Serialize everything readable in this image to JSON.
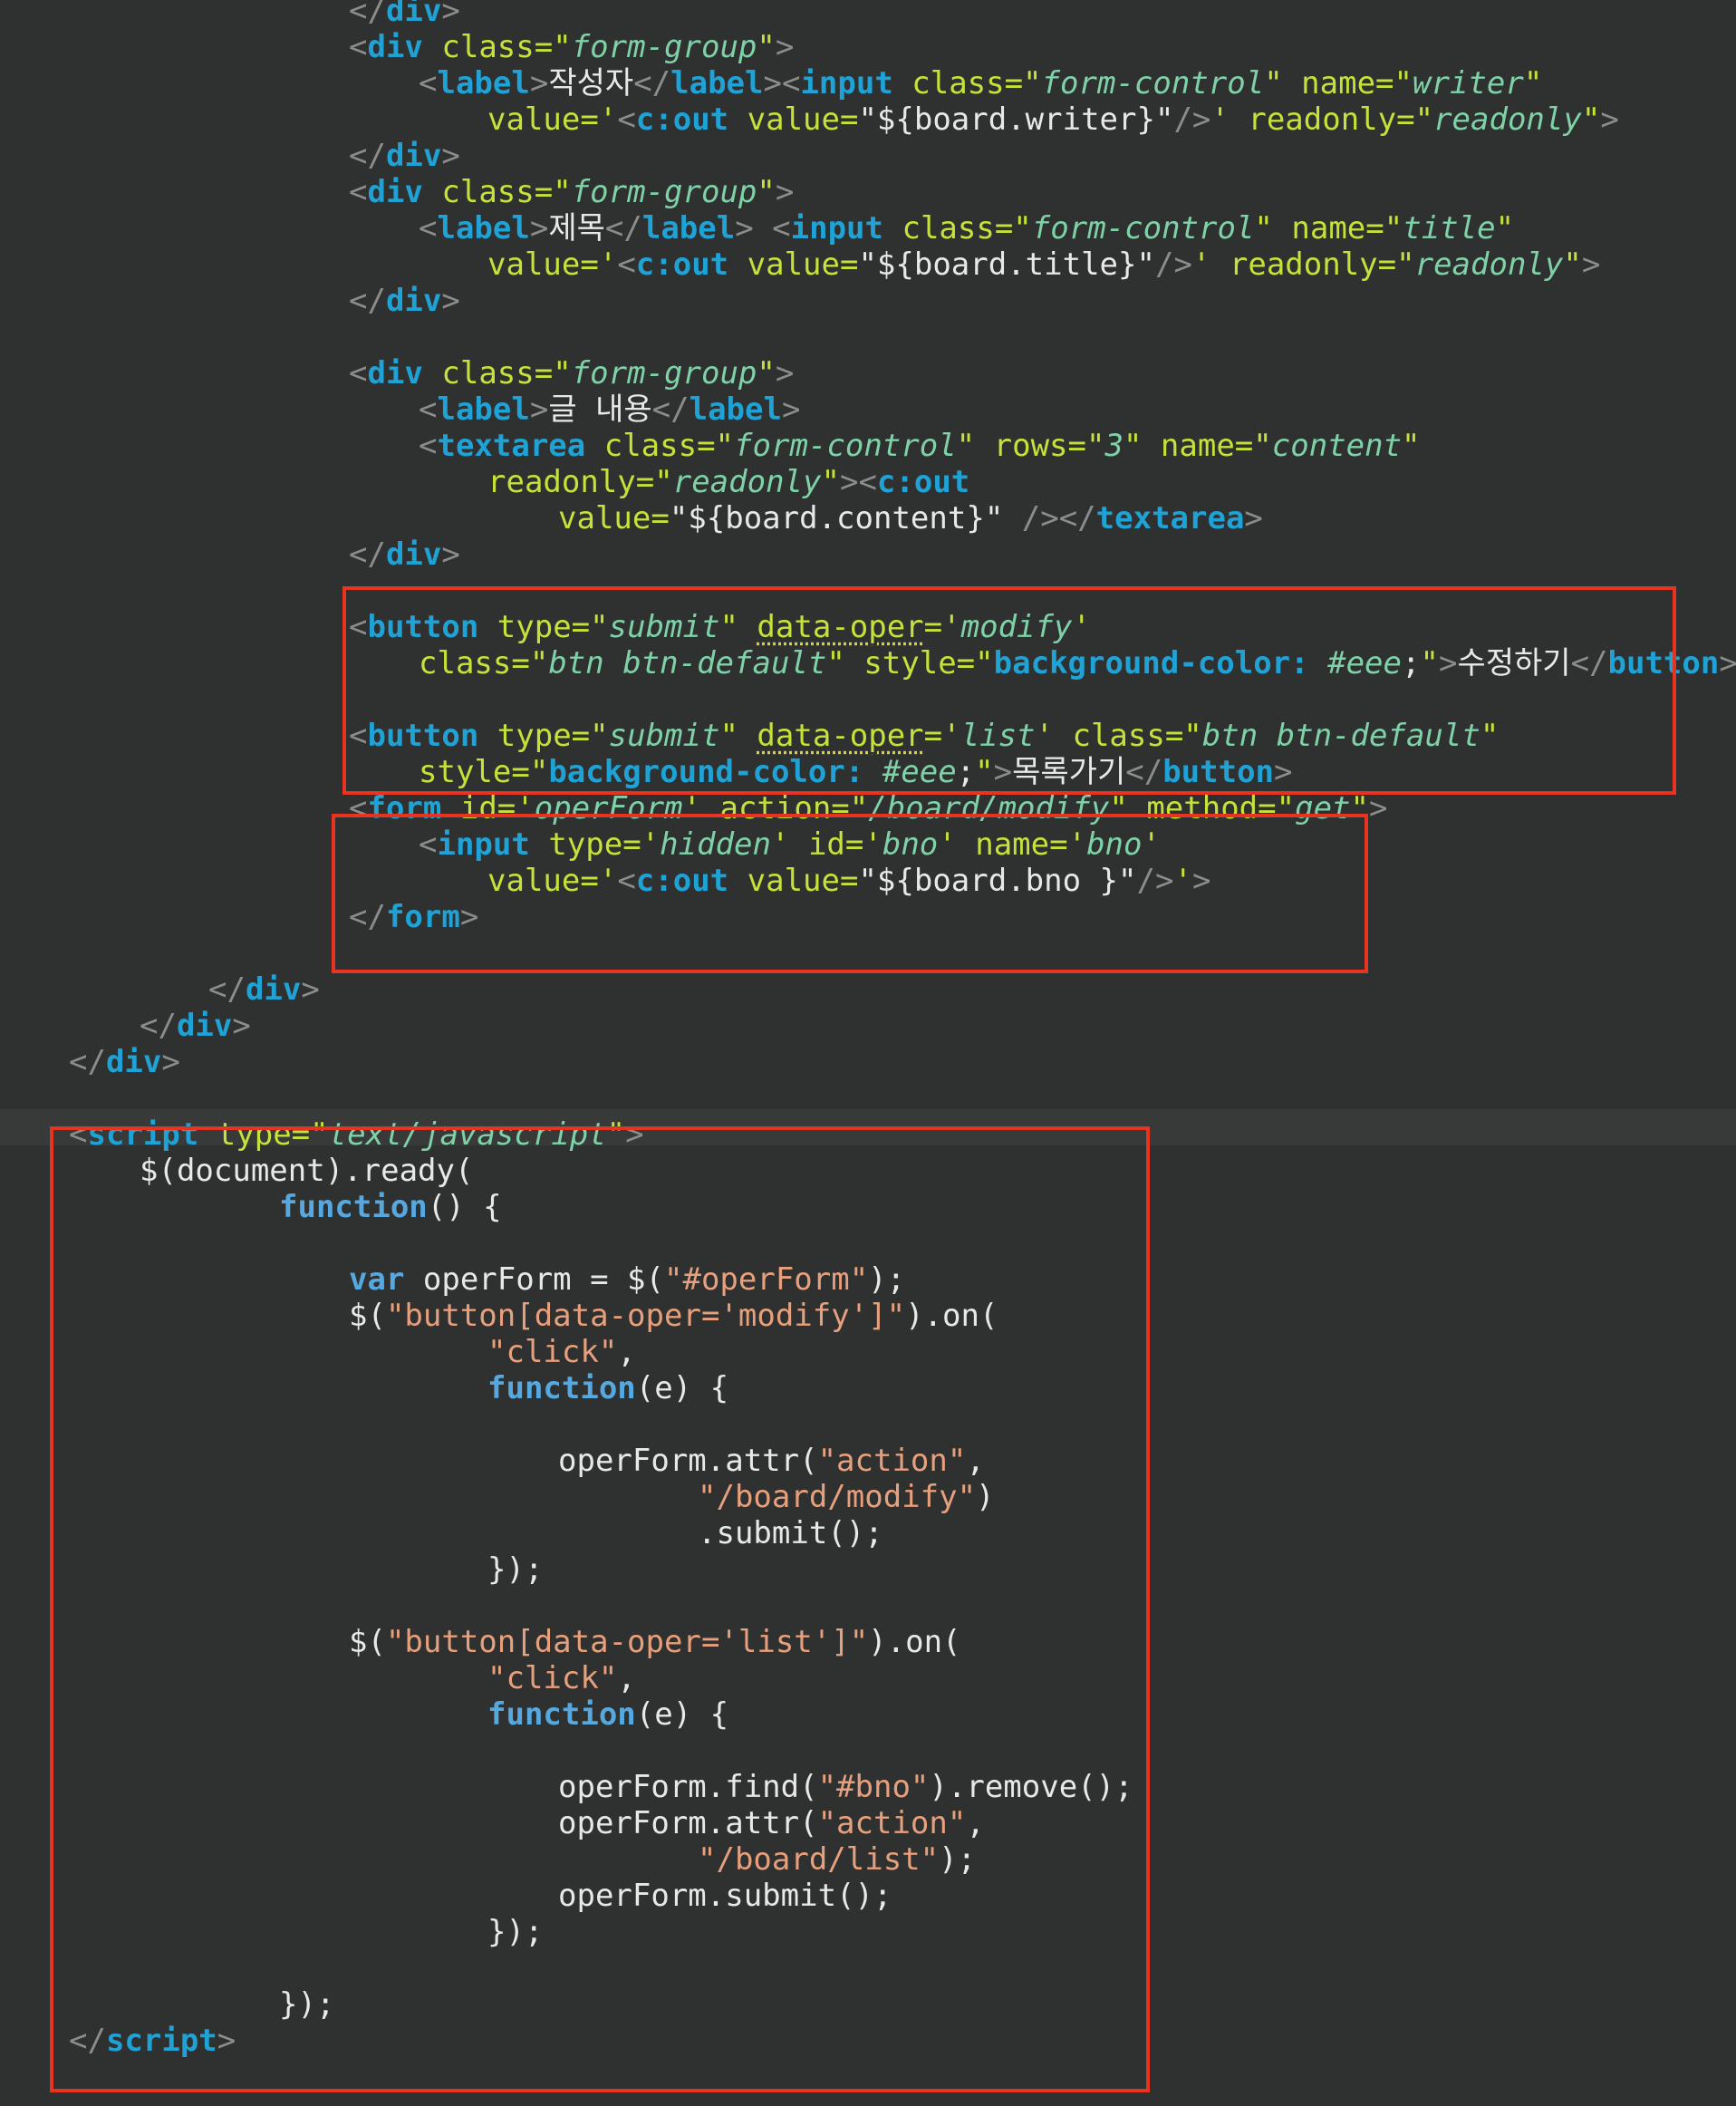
{
  "editor": {
    "colors": {
      "background": "#2f3030",
      "current_line": "#383939",
      "tag": "#1fa3d6",
      "attribute": "#c4e23a",
      "html_string": "#7fd1a8",
      "js_string": "#e7a07d",
      "keyword": "#56a8e0",
      "bracket": "#8c8c8c",
      "plain": "#e8e8e8",
      "highlight_box": "#e63322"
    },
    "lines": [
      [
        {
          "t": "</",
          "c": "bracket"
        },
        {
          "t": "div",
          "c": "tag"
        },
        {
          "t": ">",
          "c": "bracket"
        }
      ],
      [
        {
          "t": "<",
          "c": "bracket"
        },
        {
          "t": "div",
          "c": "tag"
        },
        {
          "t": " class=",
          "c": "attr"
        },
        {
          "t": "\"",
          "c": "attr"
        },
        {
          "t": "form-group",
          "c": "str"
        },
        {
          "t": "\"",
          "c": "attr"
        },
        {
          "t": ">",
          "c": "bracket"
        }
      ],
      [
        {
          "t": "<",
          "c": "bracket"
        },
        {
          "t": "label",
          "c": "tag"
        },
        {
          "t": ">",
          "c": "bracket"
        },
        {
          "t": "작성자",
          "c": "plain"
        },
        {
          "t": "</",
          "c": "bracket"
        },
        {
          "t": "label",
          "c": "tag"
        },
        {
          "t": "><",
          "c": "bracket"
        },
        {
          "t": "input",
          "c": "tag"
        },
        {
          "t": " class=",
          "c": "attr"
        },
        {
          "t": "\"",
          "c": "attr"
        },
        {
          "t": "form-control",
          "c": "str"
        },
        {
          "t": "\"",
          "c": "attr"
        },
        {
          "t": " name=",
          "c": "attr"
        },
        {
          "t": "\"",
          "c": "attr"
        },
        {
          "t": "writer",
          "c": "str"
        },
        {
          "t": "\"",
          "c": "attr"
        }
      ],
      [
        {
          "t": "value=",
          "c": "attr"
        },
        {
          "t": "'",
          "c": "attr"
        },
        {
          "t": "<",
          "c": "bracket"
        },
        {
          "t": "c:out",
          "c": "tag"
        },
        {
          "t": " value=",
          "c": "attr"
        },
        {
          "t": "\"${board.writer}\"",
          "c": "plain"
        },
        {
          "t": "/>",
          "c": "bracket"
        },
        {
          "t": "'",
          "c": "attr"
        },
        {
          "t": " readonly=",
          "c": "attr"
        },
        {
          "t": "\"",
          "c": "attr"
        },
        {
          "t": "readonly",
          "c": "str"
        },
        {
          "t": "\"",
          "c": "attr"
        },
        {
          "t": ">",
          "c": "bracket"
        }
      ],
      [
        {
          "t": "</",
          "c": "bracket"
        },
        {
          "t": "div",
          "c": "tag"
        },
        {
          "t": ">",
          "c": "bracket"
        }
      ],
      [
        {
          "t": "<",
          "c": "bracket"
        },
        {
          "t": "div",
          "c": "tag"
        },
        {
          "t": " class=",
          "c": "attr"
        },
        {
          "t": "\"",
          "c": "attr"
        },
        {
          "t": "form-group",
          "c": "str"
        },
        {
          "t": "\"",
          "c": "attr"
        },
        {
          "t": ">",
          "c": "bracket"
        }
      ],
      [
        {
          "t": "<",
          "c": "bracket"
        },
        {
          "t": "label",
          "c": "tag"
        },
        {
          "t": ">",
          "c": "bracket"
        },
        {
          "t": "제목",
          "c": "plain"
        },
        {
          "t": "</",
          "c": "bracket"
        },
        {
          "t": "label",
          "c": "tag"
        },
        {
          "t": ">",
          "c": "bracket"
        },
        {
          "t": " <",
          "c": "bracket"
        },
        {
          "t": "input",
          "c": "tag"
        },
        {
          "t": " class=",
          "c": "attr"
        },
        {
          "t": "\"",
          "c": "attr"
        },
        {
          "t": "form-control",
          "c": "str"
        },
        {
          "t": "\"",
          "c": "attr"
        },
        {
          "t": " name=",
          "c": "attr"
        },
        {
          "t": "\"",
          "c": "attr"
        },
        {
          "t": "title",
          "c": "str"
        },
        {
          "t": "\"",
          "c": "attr"
        }
      ],
      [
        {
          "t": "value=",
          "c": "attr"
        },
        {
          "t": "'",
          "c": "attr"
        },
        {
          "t": "<",
          "c": "bracket"
        },
        {
          "t": "c:out",
          "c": "tag"
        },
        {
          "t": " value=",
          "c": "attr"
        },
        {
          "t": "\"${board.title}\"",
          "c": "plain"
        },
        {
          "t": "/>",
          "c": "bracket"
        },
        {
          "t": "'",
          "c": "attr"
        },
        {
          "t": " readonly=",
          "c": "attr"
        },
        {
          "t": "\"",
          "c": "attr"
        },
        {
          "t": "readonly",
          "c": "str"
        },
        {
          "t": "\"",
          "c": "attr"
        },
        {
          "t": ">",
          "c": "bracket"
        }
      ],
      [
        {
          "t": "</",
          "c": "bracket"
        },
        {
          "t": "div",
          "c": "tag"
        },
        {
          "t": ">",
          "c": "bracket"
        }
      ],
      [],
      [
        {
          "t": "<",
          "c": "bracket"
        },
        {
          "t": "div",
          "c": "tag"
        },
        {
          "t": " class=",
          "c": "attr"
        },
        {
          "t": "\"",
          "c": "attr"
        },
        {
          "t": "form-group",
          "c": "str"
        },
        {
          "t": "\"",
          "c": "attr"
        },
        {
          "t": ">",
          "c": "bracket"
        }
      ],
      [
        {
          "t": "<",
          "c": "bracket"
        },
        {
          "t": "label",
          "c": "tag"
        },
        {
          "t": ">",
          "c": "bracket"
        },
        {
          "t": "글 내용",
          "c": "plain"
        },
        {
          "t": "</",
          "c": "bracket"
        },
        {
          "t": "label",
          "c": "tag"
        },
        {
          "t": ">",
          "c": "bracket"
        }
      ],
      [
        {
          "t": "<",
          "c": "bracket"
        },
        {
          "t": "textarea",
          "c": "tag"
        },
        {
          "t": " class=",
          "c": "attr"
        },
        {
          "t": "\"",
          "c": "attr"
        },
        {
          "t": "form-control",
          "c": "str"
        },
        {
          "t": "\"",
          "c": "attr"
        },
        {
          "t": " rows=",
          "c": "attr"
        },
        {
          "t": "\"",
          "c": "attr"
        },
        {
          "t": "3",
          "c": "str"
        },
        {
          "t": "\"",
          "c": "attr"
        },
        {
          "t": " name=",
          "c": "attr"
        },
        {
          "t": "\"",
          "c": "attr"
        },
        {
          "t": "content",
          "c": "str"
        },
        {
          "t": "\"",
          "c": "attr"
        }
      ],
      [
        {
          "t": "readonly=",
          "c": "attr"
        },
        {
          "t": "\"",
          "c": "attr"
        },
        {
          "t": "readonly",
          "c": "str"
        },
        {
          "t": "\"",
          "c": "attr"
        },
        {
          "t": "><",
          "c": "bracket"
        },
        {
          "t": "c:out",
          "c": "tag"
        }
      ],
      [
        {
          "t": "value=",
          "c": "attr"
        },
        {
          "t": "\"${board.content}\"",
          "c": "plain"
        },
        {
          "t": " /></",
          "c": "bracket"
        },
        {
          "t": "textarea",
          "c": "tag"
        },
        {
          "t": ">",
          "c": "bracket"
        }
      ],
      [
        {
          "t": "</",
          "c": "bracket"
        },
        {
          "t": "div",
          "c": "tag"
        },
        {
          "t": ">",
          "c": "bracket"
        }
      ],
      [],
      [
        {
          "t": "<",
          "c": "bracket"
        },
        {
          "t": "button",
          "c": "tag"
        },
        {
          "t": " type=",
          "c": "attr"
        },
        {
          "t": "\"",
          "c": "attr"
        },
        {
          "t": "submit",
          "c": "str"
        },
        {
          "t": "\"",
          "c": "attr"
        },
        {
          "t": " ",
          "c": "plain"
        },
        {
          "t": "data-oper",
          "c": "warn"
        },
        {
          "t": "=",
          "c": "attr"
        },
        {
          "t": "'",
          "c": "attr"
        },
        {
          "t": "modify",
          "c": "str"
        },
        {
          "t": "'",
          "c": "attr"
        }
      ],
      [
        {
          "t": "class=",
          "c": "attr"
        },
        {
          "t": "\"",
          "c": "attr"
        },
        {
          "t": "btn btn-default",
          "c": "str"
        },
        {
          "t": "\"",
          "c": "attr"
        },
        {
          "t": " style=",
          "c": "attr"
        },
        {
          "t": "\"",
          "c": "attr"
        },
        {
          "t": "background-color:",
          "c": "tag"
        },
        {
          "t": " #eee",
          "c": "str"
        },
        {
          "t": ";",
          "c": "plain"
        },
        {
          "t": "\"",
          "c": "attr"
        },
        {
          "t": ">",
          "c": "bracket"
        },
        {
          "t": "수정하기",
          "c": "plain"
        },
        {
          "t": "</",
          "c": "bracket"
        },
        {
          "t": "button",
          "c": "tag"
        },
        {
          "t": ">",
          "c": "bracket"
        }
      ],
      [],
      [
        {
          "t": "<",
          "c": "bracket"
        },
        {
          "t": "button",
          "c": "tag"
        },
        {
          "t": " type=",
          "c": "attr"
        },
        {
          "t": "\"",
          "c": "attr"
        },
        {
          "t": "submit",
          "c": "str"
        },
        {
          "t": "\"",
          "c": "attr"
        },
        {
          "t": " ",
          "c": "plain"
        },
        {
          "t": "data-oper",
          "c": "warn"
        },
        {
          "t": "=",
          "c": "attr"
        },
        {
          "t": "'",
          "c": "attr"
        },
        {
          "t": "list",
          "c": "str"
        },
        {
          "t": "'",
          "c": "attr"
        },
        {
          "t": " class=",
          "c": "attr"
        },
        {
          "t": "\"",
          "c": "attr"
        },
        {
          "t": "btn btn-default",
          "c": "str"
        },
        {
          "t": "\"",
          "c": "attr"
        }
      ],
      [
        {
          "t": "style=",
          "c": "attr"
        },
        {
          "t": "\"",
          "c": "attr"
        },
        {
          "t": "background-color:",
          "c": "tag"
        },
        {
          "t": " #eee",
          "c": "str"
        },
        {
          "t": ";",
          "c": "plain"
        },
        {
          "t": "\"",
          "c": "attr"
        },
        {
          "t": ">",
          "c": "bracket"
        },
        {
          "t": "목록가기",
          "c": "plain"
        },
        {
          "t": "</",
          "c": "bracket"
        },
        {
          "t": "button",
          "c": "tag"
        },
        {
          "t": ">",
          "c": "bracket"
        }
      ],
      [
        {
          "t": "<",
          "c": "bracket"
        },
        {
          "t": "form",
          "c": "tag"
        },
        {
          "t": " id=",
          "c": "attr"
        },
        {
          "t": "'",
          "c": "attr"
        },
        {
          "t": "operForm",
          "c": "str"
        },
        {
          "t": "'",
          "c": "attr"
        },
        {
          "t": " action=",
          "c": "attr"
        },
        {
          "t": "\"",
          "c": "attr"
        },
        {
          "t": "/board/modify",
          "c": "str"
        },
        {
          "t": "\"",
          "c": "attr"
        },
        {
          "t": " method=",
          "c": "attr"
        },
        {
          "t": "\"",
          "c": "attr"
        },
        {
          "t": "get",
          "c": "str"
        },
        {
          "t": "\"",
          "c": "attr"
        },
        {
          "t": ">",
          "c": "bracket"
        }
      ],
      [
        {
          "t": "<",
          "c": "bracket"
        },
        {
          "t": "input",
          "c": "tag"
        },
        {
          "t": " type=",
          "c": "attr"
        },
        {
          "t": "'",
          "c": "attr"
        },
        {
          "t": "hidden",
          "c": "str"
        },
        {
          "t": "'",
          "c": "attr"
        },
        {
          "t": " id=",
          "c": "attr"
        },
        {
          "t": "'",
          "c": "attr"
        },
        {
          "t": "bno",
          "c": "str"
        },
        {
          "t": "'",
          "c": "attr"
        },
        {
          "t": " name=",
          "c": "attr"
        },
        {
          "t": "'",
          "c": "attr"
        },
        {
          "t": "bno",
          "c": "str"
        },
        {
          "t": "'",
          "c": "attr"
        }
      ],
      [
        {
          "t": "value=",
          "c": "attr"
        },
        {
          "t": "'",
          "c": "attr"
        },
        {
          "t": "<",
          "c": "bracket"
        },
        {
          "t": "c:out",
          "c": "tag"
        },
        {
          "t": " value=",
          "c": "attr"
        },
        {
          "t": "\"${board.bno }\"",
          "c": "plain"
        },
        {
          "t": "/>",
          "c": "bracket"
        },
        {
          "t": "'",
          "c": "attr"
        },
        {
          "t": ">",
          "c": "bracket"
        }
      ],
      [
        {
          "t": "</",
          "c": "bracket"
        },
        {
          "t": "form",
          "c": "tag"
        },
        {
          "t": ">",
          "c": "bracket"
        }
      ],
      [],
      [
        {
          "t": "</",
          "c": "bracket"
        },
        {
          "t": "div",
          "c": "tag"
        },
        {
          "t": ">",
          "c": "bracket"
        }
      ],
      [
        {
          "t": "</",
          "c": "bracket"
        },
        {
          "t": "div",
          "c": "tag"
        },
        {
          "t": ">",
          "c": "bracket"
        }
      ],
      [
        {
          "t": "</",
          "c": "bracket"
        },
        {
          "t": "div",
          "c": "tag"
        },
        {
          "t": ">",
          "c": "bracket"
        }
      ],
      [],
      [
        {
          "t": "<",
          "c": "bracket"
        },
        {
          "t": "script",
          "c": "tag"
        },
        {
          "t": " type=",
          "c": "attr"
        },
        {
          "t": "\"",
          "c": "attr"
        },
        {
          "t": "text/javascript",
          "c": "str"
        },
        {
          "t": "\"",
          "c": "attr"
        },
        {
          "t": ">",
          "c": "bracket"
        }
      ],
      [
        {
          "t": "$(document).ready(",
          "c": "plain"
        }
      ],
      [
        {
          "t": "function",
          "c": "kw"
        },
        {
          "t": "() {",
          "c": "plain"
        }
      ],
      [],
      [
        {
          "t": "var",
          "c": "kw"
        },
        {
          "t": " operForm = $(",
          "c": "plain"
        },
        {
          "t": "\"#operForm\"",
          "c": "jsstr"
        },
        {
          "t": ");",
          "c": "plain"
        }
      ],
      [
        {
          "t": "$(",
          "c": "plain"
        },
        {
          "t": "\"button[data-oper='modify']\"",
          "c": "jsstr"
        },
        {
          "t": ").on(",
          "c": "plain"
        }
      ],
      [
        {
          "t": "\"click\"",
          "c": "jsstr"
        },
        {
          "t": ",",
          "c": "plain"
        }
      ],
      [
        {
          "t": "function",
          "c": "kw"
        },
        {
          "t": "(e) {",
          "c": "plain"
        }
      ],
      [],
      [
        {
          "t": "operForm.attr(",
          "c": "plain"
        },
        {
          "t": "\"action\"",
          "c": "jsstr"
        },
        {
          "t": ",",
          "c": "plain"
        }
      ],
      [
        {
          "t": "\"/board/modify\"",
          "c": "jsstr"
        },
        {
          "t": ")",
          "c": "plain"
        }
      ],
      [
        {
          "t": ".submit();",
          "c": "plain"
        }
      ],
      [
        {
          "t": "});",
          "c": "plain"
        }
      ],
      [],
      [
        {
          "t": "$(",
          "c": "plain"
        },
        {
          "t": "\"button[data-oper='list']\"",
          "c": "jsstr"
        },
        {
          "t": ").on(",
          "c": "plain"
        }
      ],
      [
        {
          "t": "\"click\"",
          "c": "jsstr"
        },
        {
          "t": ",",
          "c": "plain"
        }
      ],
      [
        {
          "t": "function",
          "c": "kw"
        },
        {
          "t": "(e) {",
          "c": "plain"
        }
      ],
      [],
      [
        {
          "t": "operForm.find(",
          "c": "plain"
        },
        {
          "t": "\"#bno\"",
          "c": "jsstr"
        },
        {
          "t": ").remove();",
          "c": "plain"
        }
      ],
      [
        {
          "t": "operForm.attr(",
          "c": "plain"
        },
        {
          "t": "\"action\"",
          "c": "jsstr"
        },
        {
          "t": ",",
          "c": "plain"
        }
      ],
      [
        {
          "t": "\"/board/list\"",
          "c": "jsstr"
        },
        {
          "t": ");",
          "c": "plain"
        }
      ],
      [
        {
          "t": "operForm.submit();",
          "c": "plain"
        }
      ],
      [
        {
          "t": "});",
          "c": "plain"
        }
      ],
      [],
      [
        {
          "t": "});",
          "c": "plain"
        }
      ],
      [
        {
          "t": "</",
          "c": "bracket"
        },
        {
          "t": "script",
          "c": "tag"
        },
        {
          "t": ">",
          "c": "bracket"
        }
      ]
    ]
  }
}
